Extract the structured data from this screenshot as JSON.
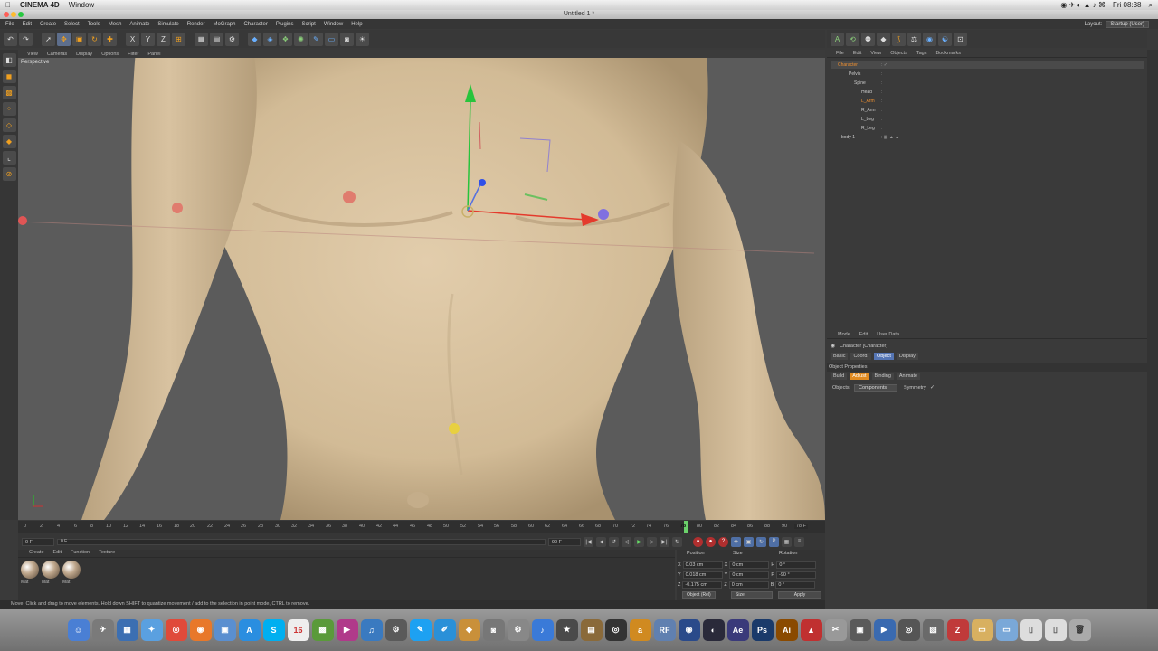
{
  "mac": {
    "app_name": "CINEMA 4D",
    "menu": "Window",
    "clock": "Fri 08:38"
  },
  "window": {
    "title": "Untitled 1 *"
  },
  "c4d_menu": [
    "File",
    "Edit",
    "Create",
    "Select",
    "Tools",
    "Mesh",
    "Animate",
    "Simulate",
    "Render",
    "MoGraph",
    "Character",
    "Plugins",
    "Script",
    "Window",
    "Help"
  ],
  "layout": {
    "label": "Layout:",
    "value": "Startup (User)"
  },
  "viewport": {
    "menu": [
      "View",
      "Cameras",
      "Display",
      "Options",
      "Filter",
      "Panel"
    ],
    "label": "Perspective"
  },
  "timeline": {
    "ticks": [
      "0",
      "2",
      "4",
      "6",
      "8",
      "10",
      "12",
      "14",
      "16",
      "18",
      "20",
      "22",
      "24",
      "26",
      "28",
      "30",
      "32",
      "34",
      "36",
      "38",
      "40",
      "42",
      "44",
      "46",
      "48",
      "50",
      "52",
      "54",
      "56",
      "58",
      "60",
      "62",
      "64",
      "66",
      "68",
      "70",
      "72",
      "74",
      "76",
      "78",
      "80",
      "82",
      "84",
      "86",
      "88",
      "90"
    ],
    "current_marker": "78",
    "current_frame": "0 F",
    "start_field": "0 F",
    "end_field": "90 F",
    "end_readout": "78 F"
  },
  "materials": {
    "menu": [
      "Create",
      "Edit",
      "Function",
      "Texture"
    ],
    "items": [
      "Mat",
      "Mat",
      "Mat"
    ]
  },
  "coords": {
    "headers": [
      "Position",
      "Size",
      "Rotation"
    ],
    "rows": [
      {
        "axis": "X",
        "pos": "0.03 cm",
        "size_axis": "X",
        "size": "0 cm",
        "rot_axis": "H",
        "rot": "0 °"
      },
      {
        "axis": "Y",
        "pos": "0.018 cm",
        "size_axis": "Y",
        "size": "0 cm",
        "rot_axis": "P",
        "rot": "-90 °"
      },
      {
        "axis": "Z",
        "pos": "-0.175 cm",
        "size_axis": "Z",
        "size": "0 cm",
        "rot_axis": "B",
        "rot": "0 °"
      }
    ],
    "mode": "Object (Rel)",
    "size_mode": "Size",
    "apply": "Apply"
  },
  "status": "Move: Click and drag to move elements. Hold down SHIFT to quantize movement / add to the selection in point mode, CTRL to remove.",
  "objects": {
    "menu": [
      "File",
      "Edit",
      "View",
      "Objects",
      "Tags",
      "Bookmarks"
    ],
    "rows": [
      {
        "name": "Character",
        "color": "#f09030"
      },
      {
        "name": "Pelvis",
        "color": "#cccccc"
      },
      {
        "name": "Spine",
        "color": "#cccccc"
      },
      {
        "name": "Head",
        "color": "#cccccc"
      },
      {
        "name": "L_Arm",
        "color": "#f09030"
      },
      {
        "name": "R_Arm",
        "color": "#cccccc"
      },
      {
        "name": "L_Leg",
        "color": "#cccccc"
      },
      {
        "name": "R_Leg",
        "color": "#cccccc"
      },
      {
        "name": "body 1",
        "color": "#cccccc"
      }
    ]
  },
  "attributes": {
    "menu": [
      "Mode",
      "Edit",
      "User Data"
    ],
    "title": "Character [Character]",
    "tabs": [
      "Basic",
      "Coord.",
      "Object",
      "Display"
    ],
    "section": "Object Properties",
    "subtabs": [
      "Build",
      "Adjust",
      "Binding",
      "Animate"
    ],
    "objects_label": "Objects",
    "objects_value": "Components",
    "symmetry_label": "Symmetry",
    "symmetry_check": "✓"
  },
  "colors": {
    "accent": "#5575b4",
    "orange": "#e08a20",
    "skin": "#d8c2a0",
    "viewport_bg": "#5b5b5b"
  }
}
